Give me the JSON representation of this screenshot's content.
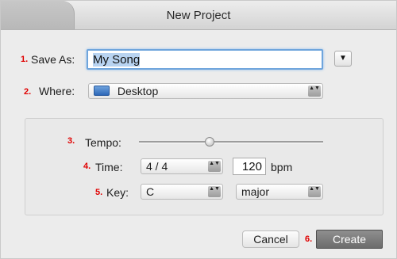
{
  "window": {
    "title": "New Project"
  },
  "steps": {
    "s1": "1.",
    "s2": "2.",
    "s3": "3.",
    "s4": "4.",
    "s5": "5.",
    "s6": "6."
  },
  "save_as": {
    "label": "Save As:",
    "value": "My Song",
    "expand_glyph": "▼"
  },
  "where": {
    "label": "Where:",
    "value": "Desktop",
    "icon": "folder-icon"
  },
  "tempo": {
    "label": "Tempo:"
  },
  "time": {
    "label": "Time:",
    "signature": "4 / 4",
    "bpm_value": "120",
    "bpm_unit": "bpm"
  },
  "key": {
    "label": "Key:",
    "note": "C",
    "mode": "major"
  },
  "buttons": {
    "cancel": "Cancel",
    "create": "Create"
  },
  "stepper_glyph": "▲▼",
  "colors": {
    "step_number": "#e00000",
    "focus_ring": "#6fa5dc",
    "create_button": "#7a7a7a"
  }
}
